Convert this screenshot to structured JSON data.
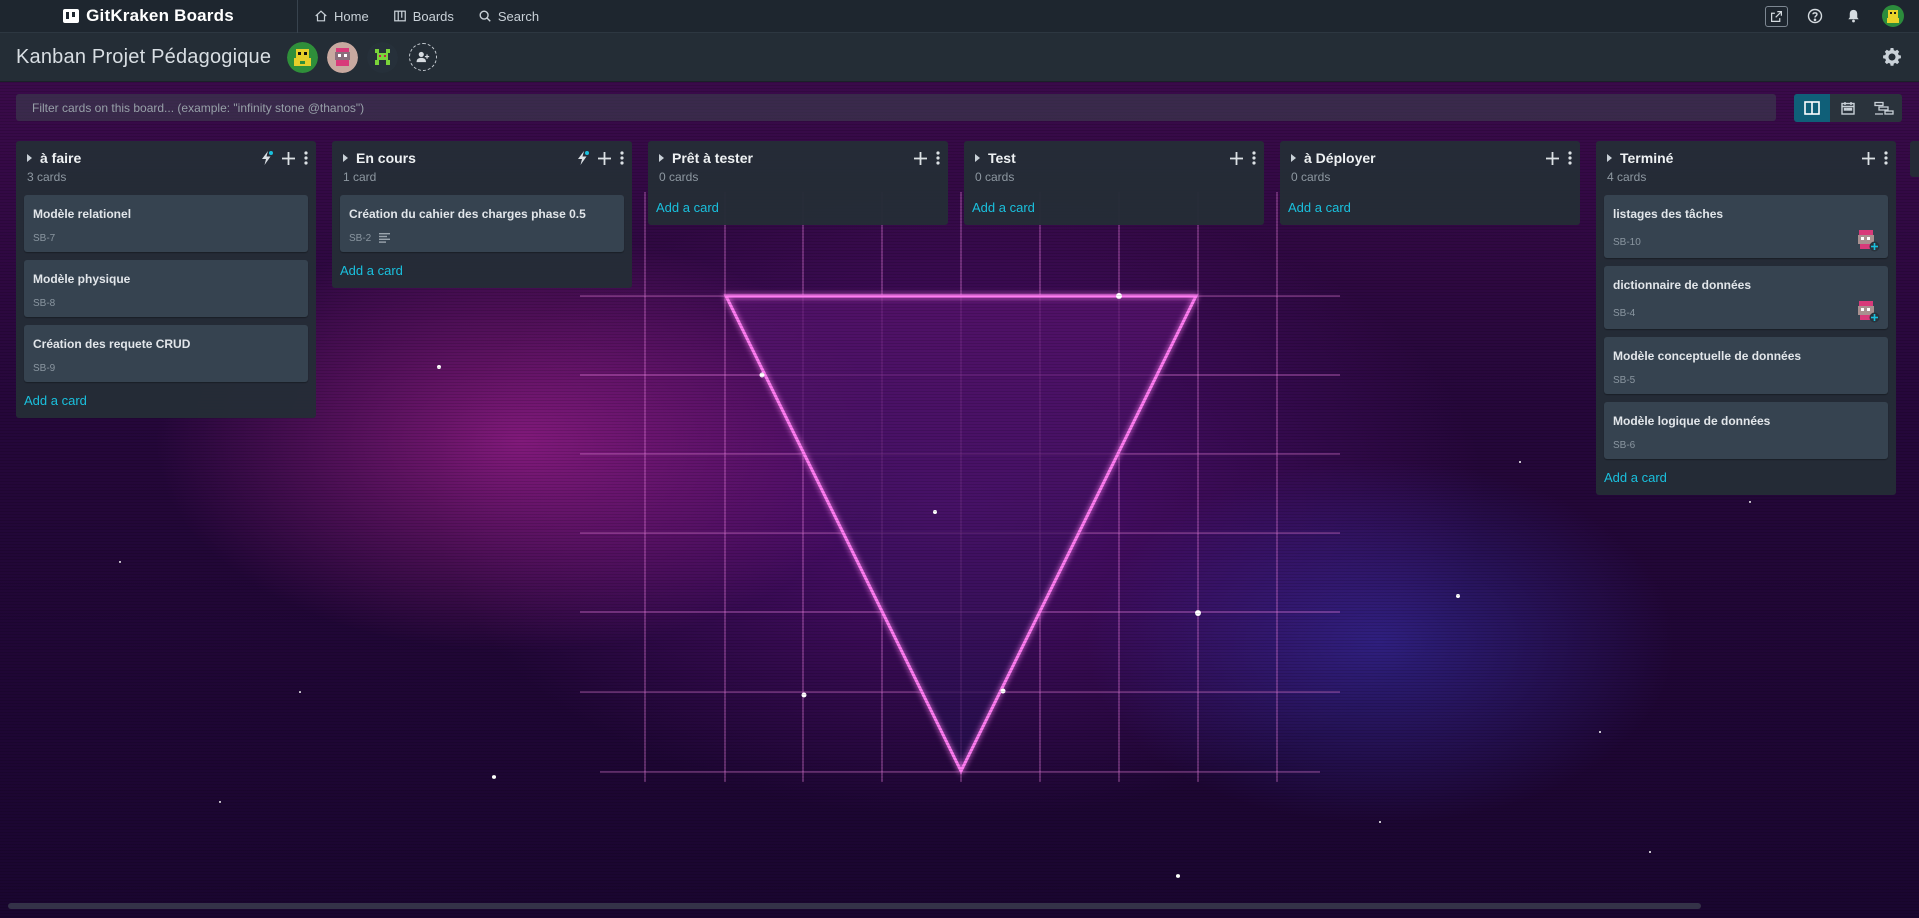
{
  "nav": {
    "brand": "GitKraken Boards",
    "links": [
      {
        "label": "Home",
        "icon": "home-icon"
      },
      {
        "label": "Boards",
        "icon": "boards-icon"
      },
      {
        "label": "Search",
        "icon": "search-icon"
      }
    ],
    "right_icons": [
      "external-link-icon",
      "help-icon",
      "bell-icon",
      "user-avatar"
    ]
  },
  "board": {
    "title": "Kanban Projet Pédagogique",
    "members": [
      "member-avatar-1",
      "member-avatar-2",
      "member-avatar-3"
    ]
  },
  "filter": {
    "placeholder": "Filter cards on this board... (example: \"infinity stone @thanos\")"
  },
  "columns": [
    {
      "title": "à faire",
      "count": "3 cards",
      "add_label": "Add a card",
      "automation": true,
      "cards": [
        {
          "title": "Modèle relationel",
          "id": "SB-7"
        },
        {
          "title": "Modèle physique",
          "id": "SB-8"
        },
        {
          "title": "Création des requete CRUD",
          "id": "SB-9"
        }
      ]
    },
    {
      "title": "En cours",
      "count": "1 card",
      "add_label": "Add a card",
      "automation": true,
      "cards": [
        {
          "title": "Création du cahier des charges phase 0.5",
          "id": "SB-2",
          "has_description": true
        }
      ]
    },
    {
      "title": "Prêt à tester",
      "count": "0 cards",
      "add_label": "Add a card",
      "automation": false,
      "cards": []
    },
    {
      "title": "Test",
      "count": "0 cards",
      "add_label": "Add a card",
      "automation": false,
      "cards": []
    },
    {
      "title": "à Déployer",
      "count": "0 cards",
      "add_label": "Add a card",
      "automation": false,
      "cards": []
    },
    {
      "title": "Terminé",
      "count": "4 cards",
      "add_label": "Add a card",
      "automation": false,
      "cards": [
        {
          "title": "listages des tâches",
          "id": "SB-10",
          "assignee": true
        },
        {
          "title": "dictionnaire de données",
          "id": "SB-4",
          "assignee": true
        },
        {
          "title": "Modèle conceptuelle de données",
          "id": "SB-5"
        },
        {
          "title": "Modèle logique de données",
          "id": "SB-6"
        }
      ]
    }
  ],
  "colors": {
    "accent": "#1ac0dd",
    "nav_bg": "#1e262f",
    "column_bg": "#242d36",
    "card_bg": "#364350",
    "active_view": "#0f5f78"
  }
}
